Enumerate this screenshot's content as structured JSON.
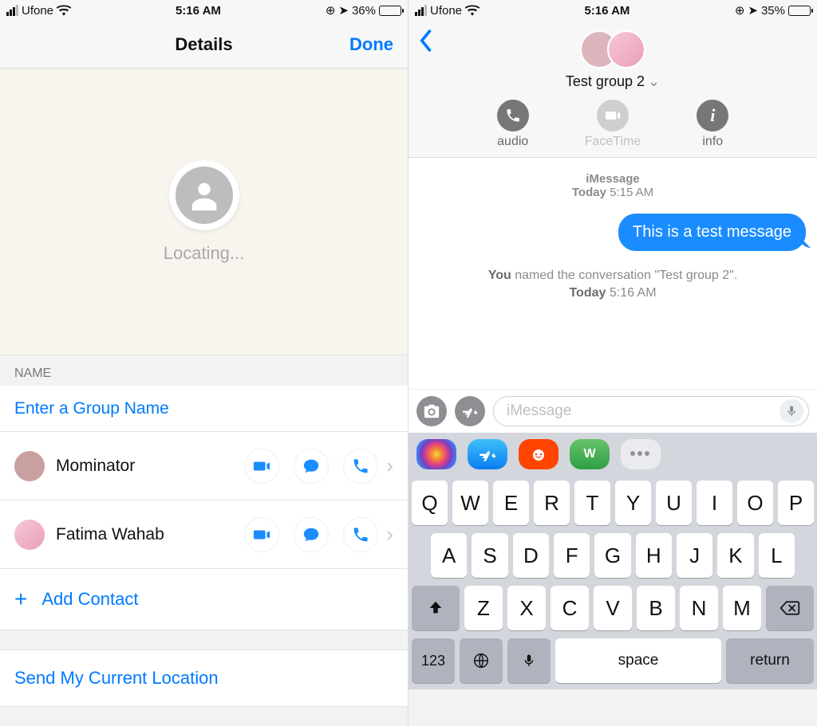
{
  "left": {
    "statusbar": {
      "carrier": "Ufone",
      "time": "5:16 AM",
      "battery_pct": "36%",
      "battery_fill": 36
    },
    "nav": {
      "title": "Details",
      "done": "Done"
    },
    "map": {
      "locating": "Locating..."
    },
    "name_section": {
      "header": "NAME",
      "placeholder": "Enter a Group Name"
    },
    "contacts": [
      {
        "name": "Mominator"
      },
      {
        "name": "Fatima Wahab"
      }
    ],
    "add_contact": "Add Contact",
    "send_location": "Send My Current Location"
  },
  "right": {
    "statusbar": {
      "carrier": "Ufone",
      "time": "5:16 AM",
      "battery_pct": "35%",
      "battery_fill": 35
    },
    "conv": {
      "name": "Test group 2",
      "btn_audio": "audio",
      "btn_facetime": "FaceTime",
      "btn_info": "info"
    },
    "thread": {
      "header_app": "iMessage",
      "header_day": "Today",
      "header_time": "5:15 AM",
      "bubble": "This is a test message",
      "sys_prefix": "You",
      "sys_text": " named the conversation \"Test group 2\".",
      "sys_day": "Today",
      "sys_time": "5:16 AM"
    },
    "input": {
      "placeholder": "iMessage"
    },
    "keyboard": {
      "row1": [
        "Q",
        "W",
        "E",
        "R",
        "T",
        "Y",
        "U",
        "I",
        "O",
        "P"
      ],
      "row2": [
        "A",
        "S",
        "D",
        "F",
        "G",
        "H",
        "J",
        "K",
        "L"
      ],
      "row3": [
        "Z",
        "X",
        "C",
        "V",
        "B",
        "N",
        "M"
      ],
      "num": "123",
      "space": "space",
      "return": "return"
    }
  }
}
